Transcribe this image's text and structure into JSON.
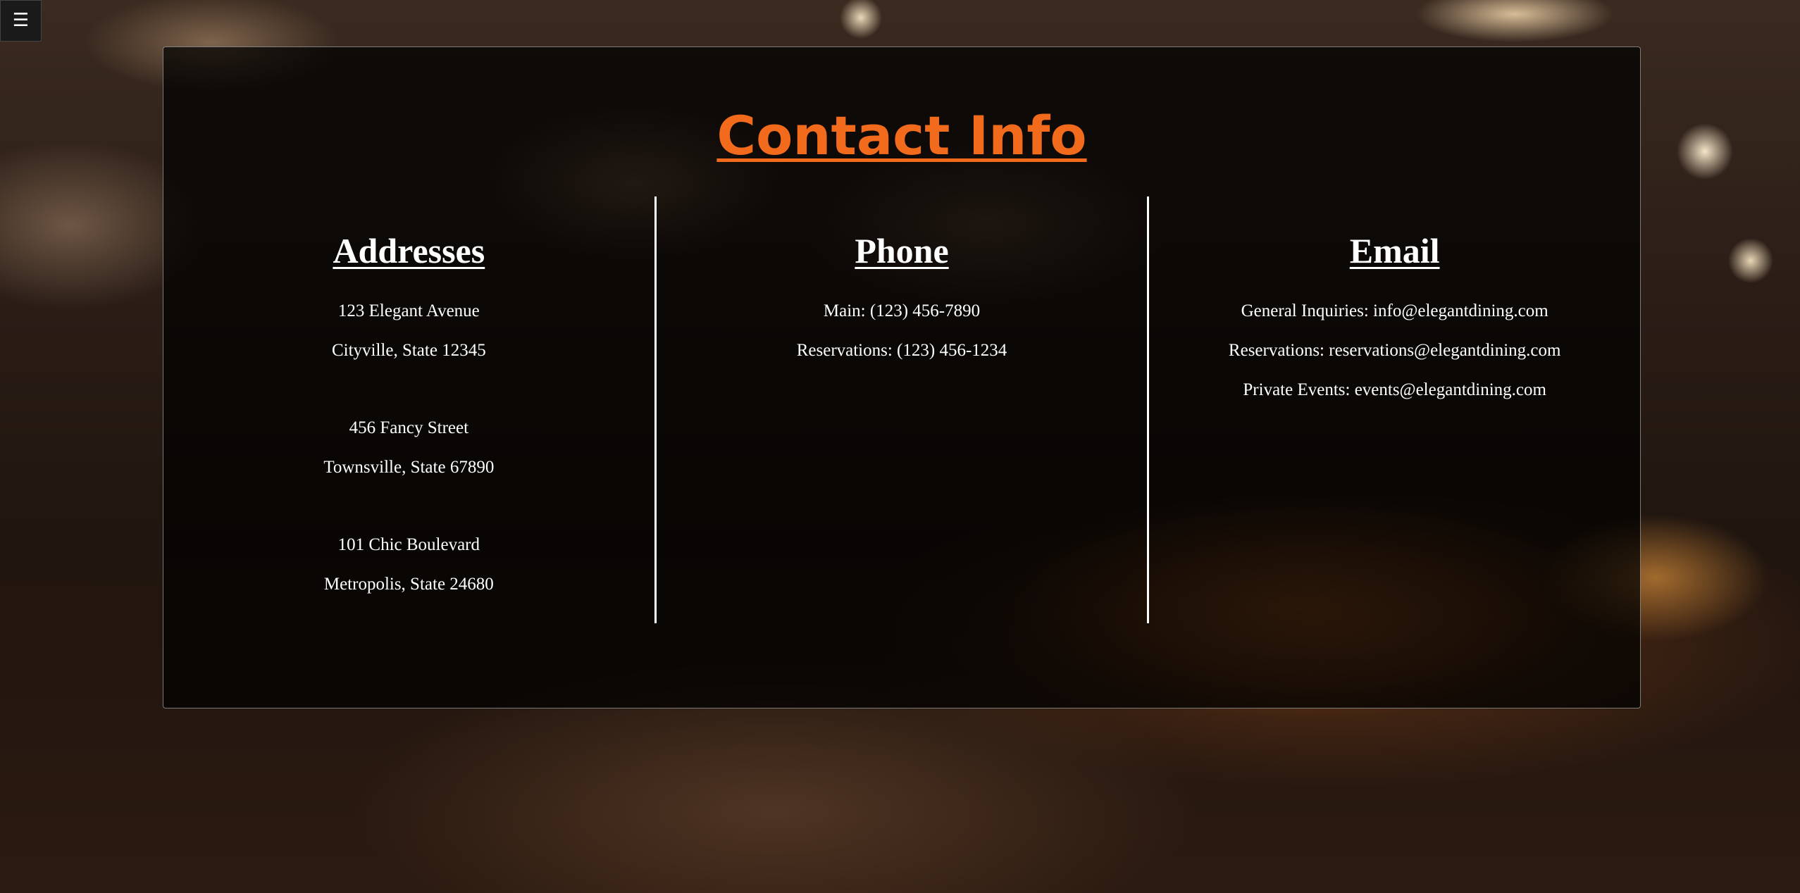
{
  "menu": {
    "icon": "hamburger-menu-icon",
    "glyph": "☰"
  },
  "title": "Contact Info",
  "colors": {
    "accent": "#f26b1d",
    "text": "#ffffff",
    "panel": "rgba(0,0,0,0.72)"
  },
  "addresses": {
    "heading": "Addresses",
    "items": [
      {
        "line1": "123 Elegant Avenue",
        "line2": "Cityville, State 12345"
      },
      {
        "line1": "456 Fancy Street",
        "line2": "Townsville, State 67890"
      },
      {
        "line1": "101 Chic Boulevard",
        "line2": "Metropolis, State 24680"
      }
    ]
  },
  "phone": {
    "heading": "Phone",
    "items": [
      "Main: (123) 456-7890",
      "Reservations: (123) 456-1234"
    ]
  },
  "email": {
    "heading": "Email",
    "items": [
      "General Inquiries: info@elegantdining.com",
      "Reservations: reservations@elegantdining.com",
      "Private Events: events@elegantdining.com"
    ]
  }
}
